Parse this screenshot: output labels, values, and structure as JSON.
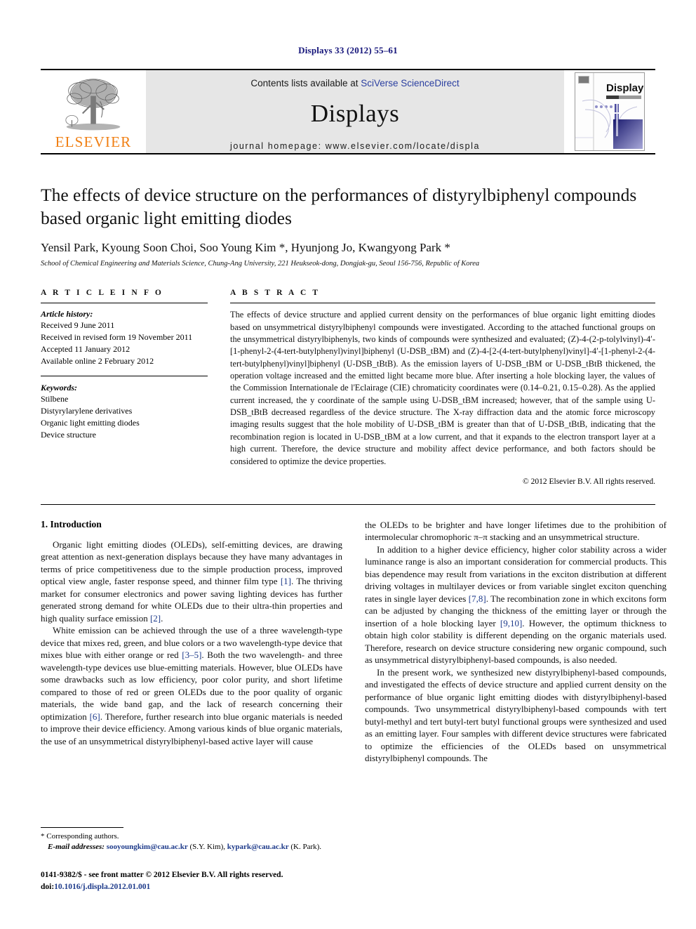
{
  "running_head": "Displays 33 (2012) 55–61",
  "banner": {
    "publisher_name": "ELSEVIER",
    "contents_prefix": "Contents lists available at ",
    "contents_link": "SciVerse ScienceDirect",
    "journal_name": "Displays",
    "homepage_line": "journal homepage: www.elsevier.com/locate/displa",
    "cover_title": "Displays"
  },
  "title": "The effects of device structure on the performances of distyrylbiphenyl compounds based organic light emitting diodes",
  "authors_parts": [
    {
      "text": "Yensil Park, Kyoung Soon Choi, Soo Young Kim"
    },
    {
      "text": "*",
      "sup": true
    },
    {
      "text": ", Hyunjong Jo, Kwangyong Park"
    },
    {
      "text": "*",
      "sup": true
    }
  ],
  "authors_plain": "Yensil Park, Kyoung Soon Choi, Soo Young Kim *, Hyunjong Jo, Kwangyong Park *",
  "affiliation": "School of Chemical Engineering and Materials Science, Chung-Ang University, 221 Heukseok-dong, Dongjak-gu, Seoul 156-756, Republic of Korea",
  "article_info": {
    "heading": "A R T I C L E    I N F O",
    "history_label": "Article history:",
    "history": [
      "Received 9 June 2011",
      "Received in revised form 19 November 2011",
      "Accepted 11 January 2012",
      "Available online 2 February 2012"
    ],
    "keywords_label": "Keywords:",
    "keywords": [
      "Stilbene",
      "Distyrylarylene derivatives",
      "Organic light emitting diodes",
      "Device structure"
    ]
  },
  "abstract": {
    "heading": "A B S T R A C T",
    "text": "The effects of device structure and applied current density on the performances of blue organic light emitting diodes based on unsymmetrical distyrylbiphenyl compounds were investigated. According to the attached functional groups on the unsymmetrical distyrylbiphenyls, two kinds of compounds were synthesized and evaluated; (Z)-4-(2-p-tolylvinyl)-4′-[1-phenyl-2-(4-tert-butylphenyl)vinyl]biphenyl (U-DSB_tBM) and (Z)-4-[2-(4-tert-butylphenyl)vinyl]-4′-[1-phenyl-2-(4-tert-butylphenyl)vinyl]biphenyl (U-DSB_tBtB). As the emission layers of U-DSB_tBM or U-DSB_tBtB thickened, the operation voltage increased and the emitted light became more blue. After inserting a hole blocking layer, the values of the Commission Internationale de l'Eclairage (CIE) chromaticity coordinates were (0.14–0.21, 0.15–0.28). As the applied current increased, the y coordinate of the sample using U-DSB_tBM increased; however, that of the sample using U-DSB_tBtB decreased regardless of the device structure. The X-ray diffraction data and the atomic force microscopy imaging results suggest that the hole mobility of U-DSB_tBM is greater than that of U-DSB_tBtB, indicating that the recombination region is located in U-DSB_tBM at a low current, and that it expands to the electron transport layer at a high current. Therefore, the device structure and mobility affect device performance, and both factors should be considered to optimize the device properties.",
    "copyright": "© 2012 Elsevier B.V. All rights reserved."
  },
  "body": {
    "section_heading": "1. Introduction",
    "left_p1_a": "Organic light emitting diodes (OLEDs), self-emitting devices, are drawing great attention as next-generation displays because they have many advantages in terms of price competitiveness due to the simple production process, improved optical view angle, faster response speed, and thinner film type ",
    "left_p1_ref1": "[1]",
    "left_p1_b": ". The thriving market for consumer electronics and power saving lighting devices has further generated strong demand for white OLEDs due to their ultra-thin properties and high quality surface emission ",
    "left_p1_ref2": "[2]",
    "left_p1_c": ".",
    "left_p2_a": "White emission can be achieved through the use of a three wavelength-type device that mixes red, green, and blue colors or a two wavelength-type device that mixes blue with either orange or red ",
    "left_p2_ref1": "[3–5]",
    "left_p2_b": ". Both the two wavelength- and three wavelength-type devices use blue-emitting materials. However, blue OLEDs have some drawbacks such as low efficiency, poor color purity, and short lifetime compared to those of red or green OLEDs due to the poor quality of organic materials, the wide band gap, and the lack of research concerning their optimization ",
    "left_p2_ref2": "[6]",
    "left_p2_c": ". Therefore, further research into blue organic materials is needed to improve their device efficiency. Among various kinds of blue organic materials, the use of an unsymmetrical distyrylbiphenyl-based active layer will cause",
    "right_p1": "the OLEDs to be brighter and have longer lifetimes due to the prohibition of intermolecular chromophoric π–π stacking and an unsymmetrical structure.",
    "right_p2_a": "In addition to a higher device efficiency, higher color stability across a wider luminance range is also an important consideration for commercial products. This bias dependence may result from variations in the exciton distribution at different driving voltages in multilayer devices or from variable singlet exciton quenching rates in single layer devices ",
    "right_p2_ref1": "[7,8]",
    "right_p2_b": ". The recombination zone in which excitons form can be adjusted by changing the thickness of the emitting layer or through the insertion of a hole blocking layer ",
    "right_p2_ref2": "[9,10]",
    "right_p2_c": ". However, the optimum thickness to obtain high color stability is different depending on the organic materials used. Therefore, research on device structure considering new organic compound, such as unsymmetrical distyrylbiphenyl-based compounds, is also needed.",
    "right_p3": "In the present work, we synthesized new distyrylbiphenyl-based compounds, and investigated the effects of device structure and applied current density on the performance of blue organic light emitting diodes with distyrylbiphenyl-based compounds. Two unsymmetrical distyrylbiphenyl-based compounds with tert butyl-methyl and tert butyl-tert butyl functional groups were synthesized and used as an emitting layer. Four samples with different device structures were fabricated to optimize the efficiencies of the OLEDs based on unsymmetrical distyrylbiphenyl compounds. The"
  },
  "footnote": {
    "corresponding": "* Corresponding authors.",
    "email_label": "E-mail addresses:",
    "email1": "sooyoungkim@cau.ac.kr",
    "email1_suffix": " (S.Y. Kim), ",
    "email2": "kypark@cau.ac.kr",
    "email2_suffix": " (K. Park)."
  },
  "bottom": {
    "front_matter": "0141-9382/$ - see front matter © 2012 Elsevier B.V. All rights reserved.",
    "doi_label": "doi:",
    "doi_value": "10.1016/j.displa.2012.01.001"
  },
  "colors": {
    "running_head": "#14147a",
    "link": "#2b3fa0",
    "reference": "#1d3a8a",
    "elsevier_orange": "#f07f13",
    "banner_gray": "#e6e6e6"
  }
}
